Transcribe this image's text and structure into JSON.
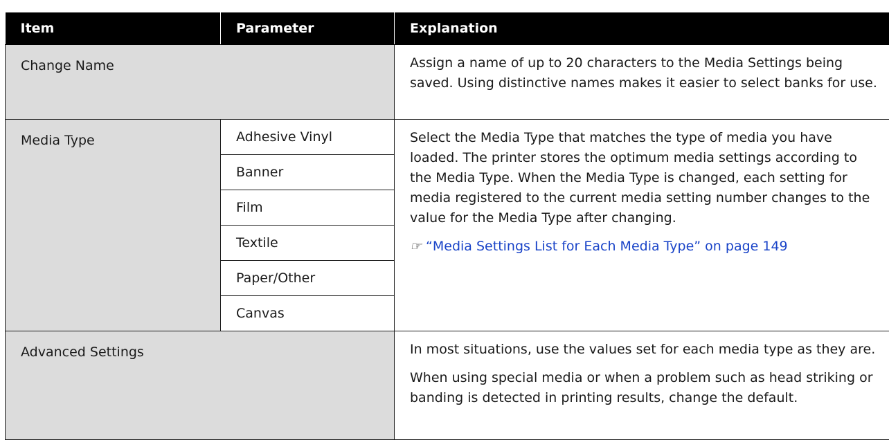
{
  "table": {
    "headers": [
      "Item",
      "Parameter",
      "Explanation"
    ],
    "change_name": {
      "item": "Change Name",
      "explanation": "Assign a name of up to 20 characters to the Media Settings being saved. Using distinctive names makes it easier to select banks for use."
    },
    "media_type": {
      "item": "Media Type",
      "parameters": [
        "Adhesive Vinyl",
        "Banner",
        "Film",
        "Textile",
        "Paper/Other",
        "Canvas"
      ],
      "explanation": "Select the Media Type that matches the type of media you have loaded. The printer stores the optimum media settings according to the Media Type. When the Media Type is changed, each setting for media registered to the current media setting number changes to the value for the Media Type after changing.",
      "ref_icon": "reference-arrow-icon",
      "link_text": "“Media Settings List for Each Media Type” on page 149"
    },
    "advanced": {
      "item": "Advanced Settings",
      "explanation_1": "In most situations, use the values set for each media type as they are.",
      "explanation_2": "When using special media or when a problem such as head striking or banding is detected in printing results, change the default."
    }
  }
}
